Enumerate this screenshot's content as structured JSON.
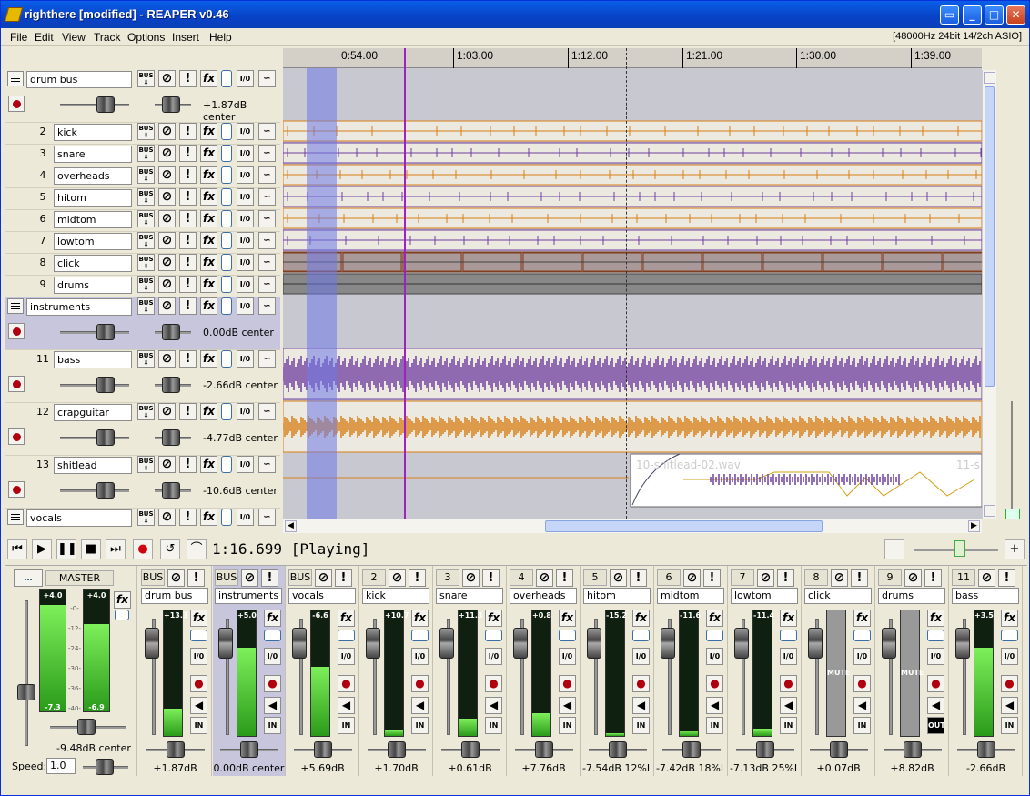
{
  "window": {
    "title": "righthere [modified] - REAPER v0.46"
  },
  "menu": {
    "items": [
      "File",
      "Edit",
      "View",
      "Track",
      "Options",
      "Insert",
      "Help"
    ],
    "info": "[48000Hz 24bit 14/2ch ASIO]"
  },
  "ruler": {
    "labels": [
      "0:54.00",
      "1:03.00",
      "1:12.00",
      "1:21.00",
      "1:30.00",
      "1:39.00"
    ]
  },
  "tracks": [
    {
      "num": "",
      "name": "drum bus",
      "folder": true,
      "vol": "+1.87dB center",
      "rowtwo": true
    },
    {
      "num": "2",
      "name": "kick"
    },
    {
      "num": "3",
      "name": "snare"
    },
    {
      "num": "4",
      "name": "overheads"
    },
    {
      "num": "5",
      "name": "hitom"
    },
    {
      "num": "6",
      "name": "midtom"
    },
    {
      "num": "7",
      "name": "lowtom"
    },
    {
      "num": "8",
      "name": "click"
    },
    {
      "num": "9",
      "name": "drums"
    },
    {
      "num": "",
      "name": "instruments",
      "folder": true,
      "vol": "0.00dB center",
      "rowtwo": true,
      "sel": true
    },
    {
      "num": "11",
      "name": "bass",
      "vol": "-2.66dB center",
      "rowtwo": true
    },
    {
      "num": "12",
      "name": "crapguitar",
      "vol": "-4.77dB center",
      "rowtwo": true
    },
    {
      "num": "13",
      "name": "shitlead",
      "vol": "-10.6dB center",
      "rowtwo": true
    },
    {
      "num": "",
      "name": "vocals",
      "folder": true
    }
  ],
  "tcp_labels": {
    "bus": "BUS",
    "fx": "fx",
    "io": "I/0",
    "solo": "!"
  },
  "item_label": "10-shitlead-02.wav",
  "item_label2": "11-s",
  "transport": {
    "time": "1:16.699 [Playing]"
  },
  "master": {
    "label": "MASTER",
    "btn": "...",
    "meterL": "+4.0",
    "meterR": "+4.0",
    "peakL": "-7.3",
    "peakR": "-6.9",
    "vol": "-9.48dB",
    "pan": "center",
    "speed_label": "Speed:",
    "speed": "1.0",
    "scale": [
      "-0-",
      "-12-",
      "-24-",
      "-30-",
      "-36-",
      "-40-"
    ]
  },
  "strips": [
    {
      "num": "BUS",
      "name": "drum bus",
      "peak": "+13.3",
      "level": 0.22,
      "val": "+1.87dB center"
    },
    {
      "num": "BUS",
      "name": "instruments",
      "peak": "+5.0",
      "level": 0.7,
      "val": "0.00dB center",
      "sel": true
    },
    {
      "num": "BUS",
      "name": "vocals",
      "peak": "-6.6",
      "level": 0.55,
      "val": "+5.69dB center"
    },
    {
      "num": "2",
      "name": "kick",
      "peak": "+10.7",
      "level": 0.05,
      "val": "+1.70dB center"
    },
    {
      "num": "3",
      "name": "snare",
      "peak": "+11.3",
      "level": 0.14,
      "val": "+0.61dB center"
    },
    {
      "num": "4",
      "name": "overheads",
      "peak": "+0.8",
      "level": 0.18,
      "val": "+7.76dB 12%L"
    },
    {
      "num": "5",
      "name": "hitom",
      "peak": "-15.2",
      "level": 0.02,
      "val": "-7.54dB 12%L"
    },
    {
      "num": "6",
      "name": "midtom",
      "peak": "-11.6",
      "level": 0.04,
      "val": "-7.42dB 18%L"
    },
    {
      "num": "7",
      "name": "lowtom",
      "peak": "-11.4",
      "level": 0.06,
      "val": "-7.13dB 25%L"
    },
    {
      "num": "8",
      "name": "click",
      "peak": "MUTE",
      "level": 0,
      "val": "+0.07dB center",
      "mute": true
    },
    {
      "num": "9",
      "name": "drums",
      "peak": "MUTE",
      "level": 0,
      "val": "+8.82dB center",
      "mute": true,
      "out": "OUT"
    },
    {
      "num": "11",
      "name": "bass",
      "peak": "+3.5",
      "level": 0.7,
      "val": "-2.66dB center"
    }
  ],
  "strip_labels": {
    "fx": "fx",
    "io": "I/0",
    "in": "IN"
  },
  "colors": {
    "orange": "#d88018",
    "purple": "#7040a0",
    "dark": "#804020"
  }
}
